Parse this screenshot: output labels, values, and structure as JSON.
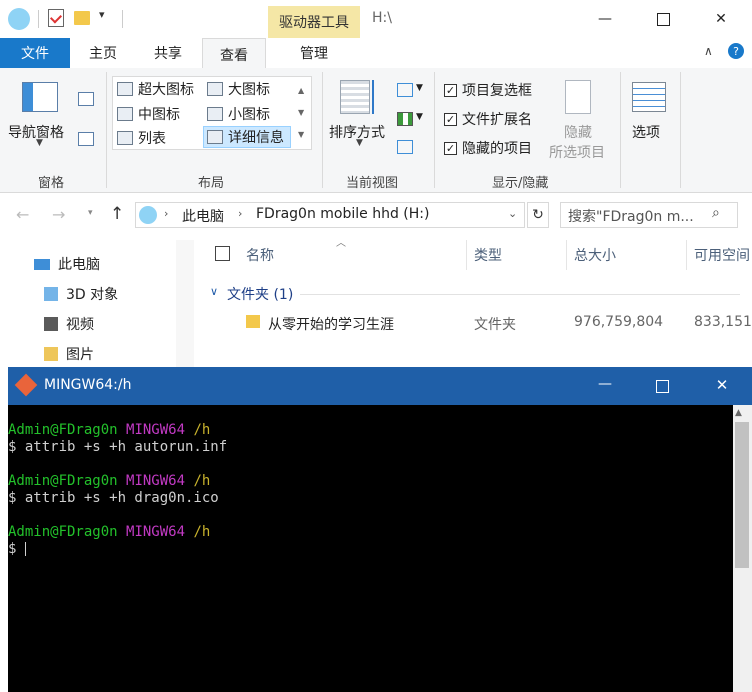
{
  "explorer": {
    "title_bar": {
      "tools_tab": "驱动器工具",
      "path": "H:\\"
    },
    "tabs": {
      "file": "文件",
      "home": "主页",
      "share": "共享",
      "view": "查看",
      "manage": "管理"
    },
    "ribbon": {
      "panes": {
        "nav_pane": "导航窗格",
        "group": "窗格"
      },
      "layout": {
        "items": [
          "超大图标",
          "大图标",
          "中图标",
          "小图标",
          "列表",
          "详细信息"
        ],
        "group": "布局"
      },
      "current_view": {
        "sort_by": "排序方式",
        "group": "当前视图"
      },
      "show_hide": {
        "item_checkboxes": "项目复选框",
        "file_extensions": "文件扩展名",
        "hidden_items": "隐藏的项目",
        "hide_selected_1": "隐藏",
        "hide_selected_2": "所选项目",
        "group": "显示/隐藏"
      },
      "options": "选项"
    },
    "address": {
      "root": "此电脑",
      "location": "FDrag0n mobile hhd (H:)"
    },
    "search": {
      "placeholder": "搜索\"FDrag0n m..."
    },
    "nav_pane": [
      "此电脑",
      "3D 对象",
      "视频",
      "图片"
    ],
    "columns": {
      "name": "名称",
      "type": "类型",
      "total_size": "总大小",
      "free_space": "可用空间"
    },
    "group_header": "文件夹 (1)",
    "rows": [
      {
        "name": "从零开始的学习生涯",
        "type": "文件夹",
        "total_size": "976,759,804",
        "free_space": "833,151"
      }
    ]
  },
  "terminal": {
    "title": "MINGW64:/h",
    "lines": [
      {
        "user": "Admin@FDrag0n",
        "env": "MINGW64",
        "path": "/h",
        "cmd": "$ attrib +s +h autorun.inf"
      },
      {
        "user": "Admin@FDrag0n",
        "env": "MINGW64",
        "path": "/h",
        "cmd": "$ attrib +s +h drag0n.ico"
      },
      {
        "user": "Admin@FDrag0n",
        "env": "MINGW64",
        "path": "/h",
        "cmd": "$ "
      }
    ]
  },
  "colors": {
    "accent_blue": "#1979ca",
    "terminal_title": "#1f5fa8",
    "tools_tab": "#f5e7a6"
  }
}
